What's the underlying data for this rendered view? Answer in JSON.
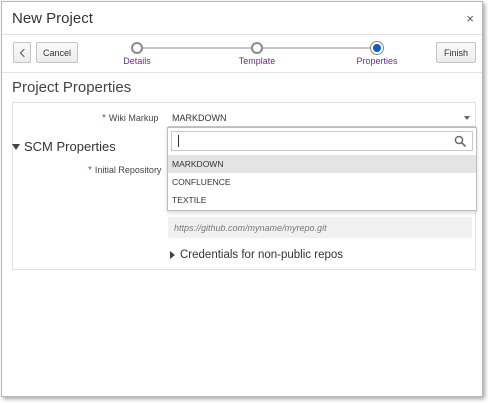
{
  "dialog": {
    "title": "New Project",
    "close_label": "×"
  },
  "toolbar": {
    "cancel_label": "Cancel",
    "finish_label": "Finish"
  },
  "train": {
    "steps": [
      {
        "label": "Details",
        "state": "visited"
      },
      {
        "label": "Template",
        "state": "visited"
      },
      {
        "label": "Properties",
        "state": "current"
      }
    ],
    "link_color": "#6b2a8f",
    "active_color": "#0b5ec8"
  },
  "page": {
    "heading": "Project Properties"
  },
  "form": {
    "required_marker": "*",
    "wiki_markup_label": "Wiki Markup",
    "wiki_markup_value": "MARKDOWN",
    "scm_section_label": "SCM Properties",
    "initial_repo_label": "Initial Repository",
    "repo_url_placeholder": "https://github.com/myname/myrepo.git",
    "credentials_label": "Credentials for non-public repos"
  },
  "dropdown": {
    "search_value": "",
    "options": [
      "MARKDOWN",
      "CONFLUENCE",
      "TEXTILE"
    ],
    "selected": "MARKDOWN"
  }
}
